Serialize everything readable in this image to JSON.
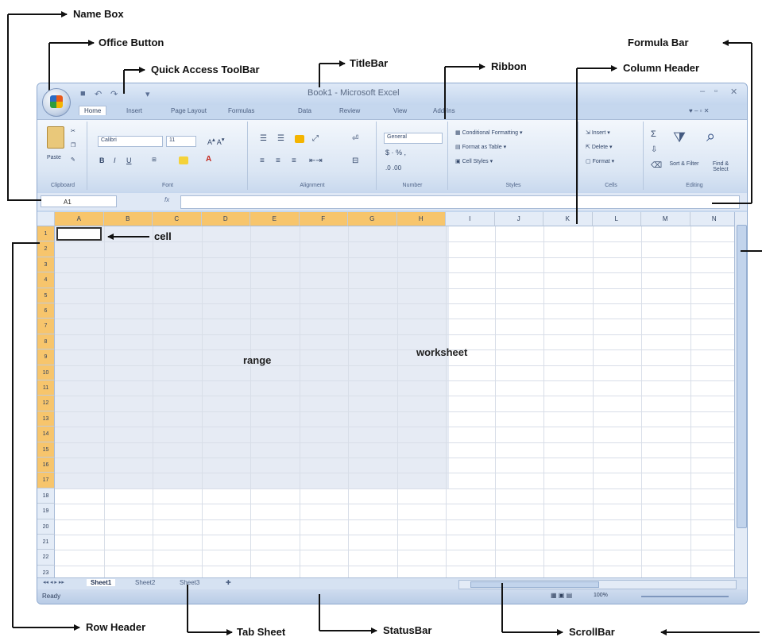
{
  "annotations": {
    "name_box": "Name Box",
    "office_button": "Office Button",
    "quick_access_toolbar": "Quick Access ToolBar",
    "title_bar": "TitleBar",
    "ribbon": "Ribbon",
    "formula_bar": "Formula Bar",
    "column_header": "Column Header",
    "cell": "cell",
    "range": "range",
    "worksheet": "worksheet",
    "row_header": "Row Header",
    "tab_sheet": "Tab Sheet",
    "status_bar": "StatusBar",
    "scroll_bar": "ScrollBar"
  },
  "excel": {
    "title": "Book1 - Microsoft Excel",
    "tabs": [
      "Home",
      "Insert",
      "Page Layout",
      "Formulas",
      "Data",
      "Review",
      "View",
      "Add-Ins"
    ],
    "ribbon": {
      "clipboard_label": "Clipboard",
      "paste_label": "Paste",
      "font_label": "Font",
      "font_name": "Calibri",
      "font_size": "11",
      "alignment_label": "Alignment",
      "number_label": "Number",
      "number_format": "General",
      "styles_label": "Styles",
      "conditional_formatting": "Conditional Formatting",
      "format_as_table": "Format as Table",
      "cell_styles": "Cell Styles",
      "cells_label": "Cells",
      "insert": "Insert",
      "delete": "Delete",
      "format": "Format",
      "editing_label": "Editing",
      "sort_filter": "Sort & Filter",
      "find_select": "Find & Select"
    },
    "name_box_value": "A1",
    "fx": "fx",
    "columns": [
      "A",
      "B",
      "C",
      "D",
      "E",
      "F",
      "G",
      "H",
      "I",
      "J",
      "K",
      "L",
      "M",
      "N"
    ],
    "rows": [
      "1",
      "2",
      "3",
      "4",
      "5",
      "6",
      "7",
      "8",
      "9",
      "10",
      "11",
      "12",
      "13",
      "14",
      "15",
      "16",
      "17",
      "18",
      "19",
      "20",
      "21",
      "22",
      "23"
    ],
    "sheets": [
      "Sheet1",
      "Sheet2",
      "Sheet3"
    ],
    "status": "Ready",
    "zoom": "100%"
  },
  "colors": {
    "selected_header": "#f7c56c",
    "range_fill": "#e6ebf4",
    "ribbon_bg": "#dbe6f4"
  }
}
